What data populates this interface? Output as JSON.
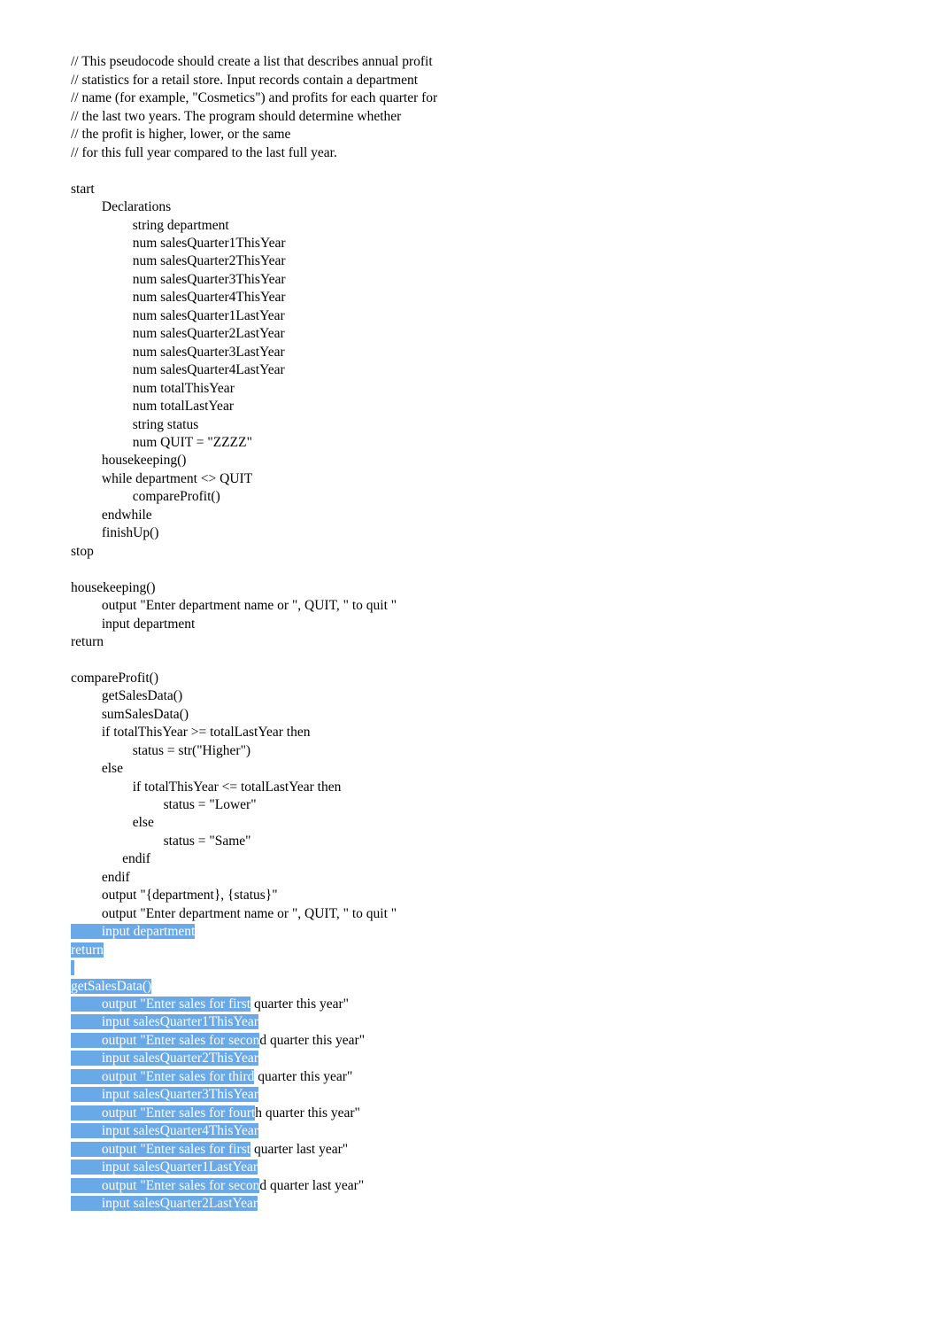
{
  "comments": [
    "// This pseudocode should create a list that describes annual profit",
    "// statistics for a retail store. Input records contain a department",
    "// name (for example, \"Cosmetics\") and profits for each quarter for",
    "// the last two years. The program should determine whether",
    "// the profit is higher, lower, or the same",
    "// for this full year compared to the last full year."
  ],
  "main": {
    "start": "start",
    "declarations": "         Declarations",
    "decls": [
      "                  string department",
      "                  num salesQuarter1ThisYear",
      "                  num salesQuarter2ThisYear",
      "                  num salesQuarter3ThisYear",
      "                  num salesQuarter4ThisYear",
      "                  num salesQuarter1LastYear",
      "                  num salesQuarter2LastYear",
      "                  num salesQuarter3LastYear",
      "                  num salesQuarter4LastYear",
      "                  num totalThisYear",
      "                  num totalLastYear",
      "                  string status",
      "                  num QUIT = \"ZZZZ\""
    ],
    "body": [
      "         housekeeping()",
      "         while department <> QUIT",
      "                  compareProfit()",
      "         endwhile",
      "         finishUp()"
    ],
    "stop": "stop"
  },
  "housekeeping": {
    "head": "housekeeping()",
    "lines": [
      "         output \"Enter department name or \", QUIT, \" to quit \"",
      "         input department"
    ],
    "ret": "return"
  },
  "compareProfit": {
    "head": "compareProfit()",
    "lines": [
      "         getSalesData()",
      "         sumSalesData()",
      "         if totalThisYear >= totalLastYear then",
      "                  status = str(\"Higher\")",
      "         else",
      "                  if totalThisYear <= totalLastYear then",
      "                           status = \"Lower\"",
      "                  else",
      "                           status = \"Same\"",
      "               endif",
      "         endif",
      "         output \"{department}, {status}\"",
      "         output \"Enter department name or \", QUIT, \" to quit \""
    ],
    "h1": "         input department",
    "h2": "return"
  },
  "getSalesData": {
    "head": "getSalesData()",
    "pairs": [
      {
        "a": "         output \"Enter sales for first",
        "b": " quarter this year\""
      },
      {
        "a": "         input salesQuarter1ThisYear",
        "b": ""
      },
      {
        "a": "         output \"Enter sales for secon",
        "b": "d quarter this year\""
      },
      {
        "a": "         input salesQuarter2ThisYear",
        "b": ""
      },
      {
        "a": "         output \"Enter sales for third",
        "b": " quarter this year\""
      },
      {
        "a": "         input salesQuarter3ThisYear",
        "b": ""
      },
      {
        "a": "         output \"Enter sales for fourt",
        "b": "h quarter this year\""
      },
      {
        "a": "         input salesQuarter4ThisYear",
        "b": ""
      },
      {
        "a": "         output \"Enter sales for first",
        "b": " quarter last year\""
      },
      {
        "a": "         input salesQuarter1LastYear",
        "b": ""
      },
      {
        "a": "         output \"Enter sales for secon",
        "b": "d quarter last year\""
      },
      {
        "a": "         input salesQuarter2LastYear",
        "b": ""
      }
    ]
  }
}
